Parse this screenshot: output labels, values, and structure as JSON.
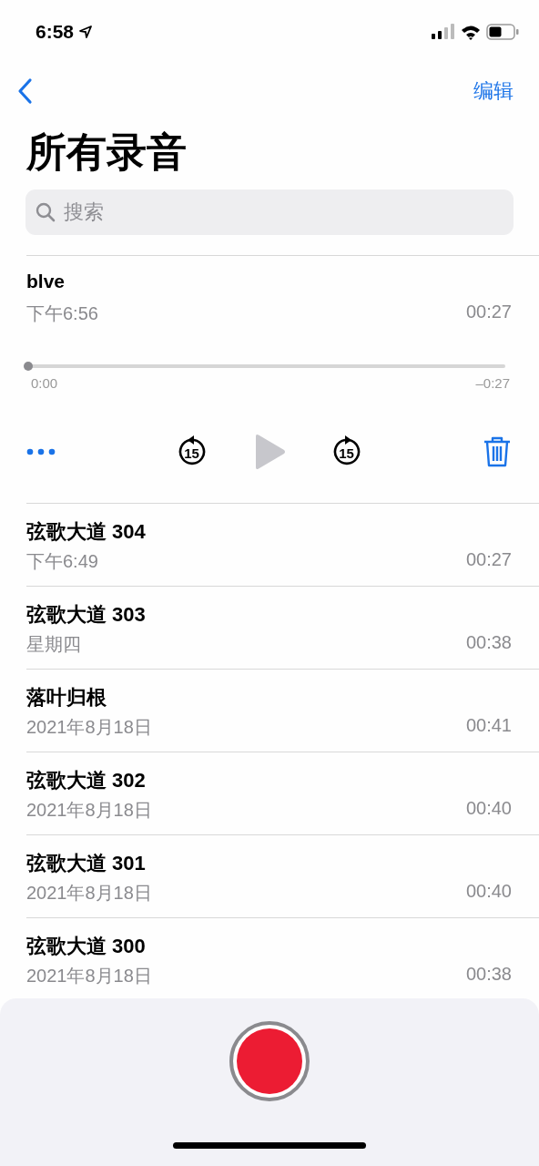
{
  "status_bar": {
    "time": "6:58"
  },
  "nav": {
    "edit": "编辑"
  },
  "title": "所有录音",
  "search": {
    "placeholder": "搜索"
  },
  "current": {
    "name": "blve",
    "date": "下午6:56",
    "duration": "00:27",
    "level": 0,
    "elapsed": "0:00",
    "remaining": "–0:27",
    "play_disabled": true,
    "skip_back": "15",
    "skip_forward": "15"
  },
  "recordings": [
    {
      "name": "弦歌大道 304",
      "date": "下午6:49",
      "duration": "00:27"
    },
    {
      "name": "弦歌大道 303",
      "date": "星期四",
      "duration": "00:38"
    },
    {
      "name": "落叶归根",
      "date": "2021年8月18日",
      "duration": "00:41"
    },
    {
      "name": "弦歌大道 302",
      "date": "2021年8月18日",
      "duration": "00:40"
    },
    {
      "name": "弦歌大道 301",
      "date": "2021年8月18日",
      "duration": "00:40"
    },
    {
      "name": "弦歌大道 300",
      "date": "2021年8月18日",
      "duration": "00:38"
    }
  ]
}
